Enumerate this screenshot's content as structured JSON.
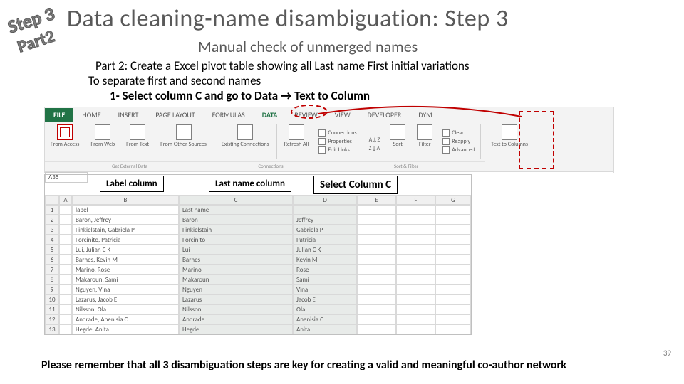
{
  "stamp": {
    "step": "Step 3",
    "part": "Part2"
  },
  "title": "Data cleaning-name disambiguation: Step 3",
  "subtitle": "Manual check of unmerged names",
  "part2": "Part 2: Create a Excel pivot table showing all Last name First initial variations",
  "separate": "To separate first and second names",
  "instruction": {
    "pre": "1- Select column C and go to Data ",
    "arrow": "→",
    "post": " Text to Column"
  },
  "ribbon": {
    "file": "FILE",
    "tabs": [
      "HOME",
      "INSERT",
      "PAGE LAYOUT",
      "FORMULAS",
      "DATA",
      "REVIEW",
      "VIEW",
      "DEVELOPER",
      "DYM"
    ],
    "activeTab": "DATA",
    "buttons": {
      "access": "From\nAccess",
      "web": "From\nWeb",
      "text": "From\nText",
      "other": "From Other\nSources",
      "existing": "Existing\nConnections",
      "refresh": "Refresh\nAll",
      "conn": "Connections",
      "prop": "Properties",
      "edit": "Edit Links",
      "sortAZ": "A↓Z",
      "sortZA": "Z↓A",
      "sort": "Sort",
      "filter": "Filter",
      "clear": "Clear",
      "reapply": "Reapply",
      "advanced": "Advanced",
      "t2c": "Text to\nColumns"
    },
    "groups": {
      "g1": "Get External Data",
      "g2": "Connections",
      "g3": "Sort & Filter"
    },
    "namebox": "A35"
  },
  "labels": {
    "l1": "Label column",
    "l2": "Last name column",
    "l3": "Select Column C"
  },
  "sheet": {
    "cols": [
      "",
      "A",
      "B",
      "C",
      "D",
      "E",
      "F",
      "G"
    ],
    "rows": [
      {
        "n": "1",
        "b": "label",
        "c": "Last name",
        "d": ""
      },
      {
        "n": "2",
        "b": "Baron, Jeffrey",
        "c": "Baron",
        "d": "Jeffrey"
      },
      {
        "n": "3",
        "b": "Finkielstain, Gabriela P",
        "c": "Finkielstain",
        "d": "Gabriela P"
      },
      {
        "n": "4",
        "b": "Forcinito, Patricia",
        "c": "Forcinito",
        "d": "Patricia"
      },
      {
        "n": "5",
        "b": "Lui, Julian C K",
        "c": "Lui",
        "d": "Julian C K"
      },
      {
        "n": "6",
        "b": "Barnes, Kevin M",
        "c": "Barnes",
        "d": "Kevin M"
      },
      {
        "n": "7",
        "b": "Marino, Rose",
        "c": "Marino",
        "d": "Rose"
      },
      {
        "n": "8",
        "b": "Makaroun, Sami",
        "c": "Makaroun",
        "d": "Sami"
      },
      {
        "n": "9",
        "b": "Nguyen, Vina",
        "c": "Nguyen",
        "d": "Vina"
      },
      {
        "n": "10",
        "b": "Lazarus, Jacob E",
        "c": "Lazarus",
        "d": "Jacob E"
      },
      {
        "n": "11",
        "b": "Nilsson, Ola",
        "c": "Nilsson",
        "d": "Ola"
      },
      {
        "n": "12",
        "b": "Andrade, Anenisia C",
        "c": "Andrade",
        "d": "Anenisia C"
      },
      {
        "n": "13",
        "b": "Hegde, Anita",
        "c": "Hegde",
        "d": "Anita"
      }
    ]
  },
  "footer": "Please remember that all 3 disambiguation steps are key for creating a valid and meaningful co-author network",
  "slideNum": "39"
}
